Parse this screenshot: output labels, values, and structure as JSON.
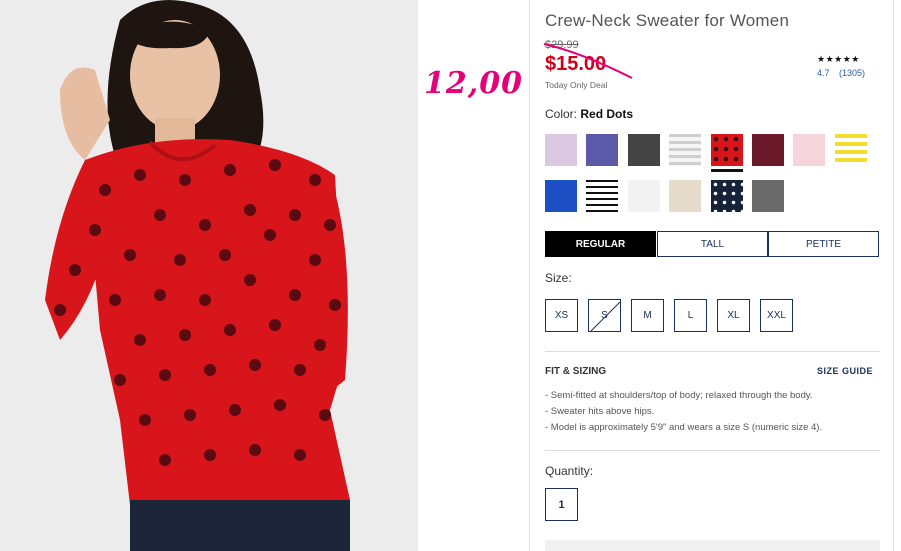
{
  "product": {
    "title": "Crew-Neck Sweater for Women",
    "old_price": "$29.99",
    "sale_price": "$15.00",
    "deal_text": "Today Only Deal",
    "handwritten_price": "12,00"
  },
  "rating": {
    "stars": "★★★★★",
    "score": "4.7",
    "count": "(1305)"
  },
  "color": {
    "label": "Color:",
    "selected": "Red Dots",
    "swatches": [
      {
        "name": "lavender",
        "color": "#d9c8e0"
      },
      {
        "name": "purple",
        "color": "#5c5aa8"
      },
      {
        "name": "charcoal",
        "color": "#444444"
      },
      {
        "name": "grey-stripe",
        "color": "#d8d8d8"
      },
      {
        "name": "red-dots",
        "color": "#d9151c"
      },
      {
        "name": "burgundy",
        "color": "#6b1a2c"
      },
      {
        "name": "light-pink",
        "color": "#f6d4dc"
      },
      {
        "name": "yellow-stripe",
        "color": "#f2de2e"
      },
      {
        "name": "royal-blue",
        "color": "#1c4fc4"
      },
      {
        "name": "black-stripe",
        "color": "#ffffff"
      },
      {
        "name": "white",
        "color": "#f2f2f2"
      },
      {
        "name": "oatmeal",
        "color": "#e6dacb"
      },
      {
        "name": "navy-dots",
        "color": "#162238"
      },
      {
        "name": "heather-grey",
        "color": "#6a6a6a"
      }
    ]
  },
  "fit": {
    "options": [
      "REGULAR",
      "TALL",
      "PETITE"
    ],
    "selected": "REGULAR"
  },
  "size": {
    "label": "Size:",
    "options": [
      "XS",
      "S",
      "M",
      "L",
      "XL",
      "XXL"
    ],
    "unavailable": [
      "S"
    ]
  },
  "fit_sizing": {
    "heading": "FIT & SIZING",
    "guide_link": "SIZE GUIDE",
    "bullets": [
      "- Semi-fitted at shoulders/top of body; relaxed through the body.",
      "- Sweater hits above hips.",
      "- Model is approximately 5'9\" and wears a size S (numeric size 4)."
    ]
  },
  "quantity": {
    "label": "Quantity:",
    "value": "1"
  },
  "colors": {
    "sale": "#d0021b",
    "navy": "#1a3060",
    "handwriting": "#e5007a"
  }
}
